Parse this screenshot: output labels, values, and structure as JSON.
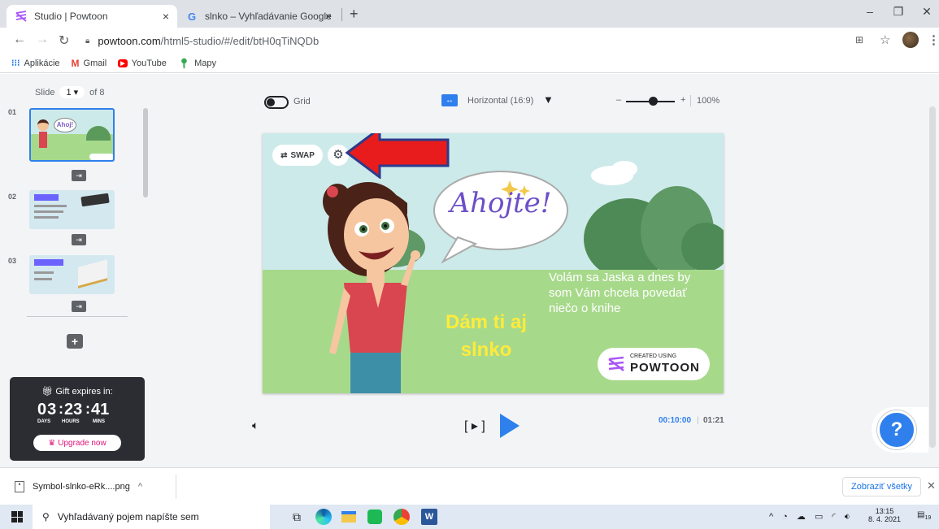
{
  "browser": {
    "tabs": [
      {
        "title": "Studio | Powtoon",
        "close": "×"
      },
      {
        "title": "slnko – Vyhľadávanie Google",
        "close": "×"
      }
    ],
    "new_tab": "+",
    "window_controls": {
      "minimize": "–",
      "restore": "❐",
      "close": "✕"
    },
    "url_domain": "powtoon.com",
    "url_path": "/html5-studio/#/edit/btH0qTiNQDb",
    "bookmarks": [
      "Aplikácie",
      "Gmail",
      "YouTube",
      "Mapy"
    ]
  },
  "sidebar": {
    "slide_label": "Slide",
    "slide_current": "1",
    "slide_of": "of 8",
    "slides": [
      {
        "number": "01"
      },
      {
        "number": "02"
      },
      {
        "number": "03"
      }
    ],
    "add_button": "+",
    "collapse": "‹",
    "gift": {
      "title": "Gift expires in:",
      "days": "03",
      "hours": "23",
      "mins": "41",
      "days_label": "DAYS",
      "hours_label": "HOURS",
      "mins_label": "MINS",
      "upgrade": "Upgrade now"
    }
  },
  "canvas_toolbar": {
    "grid_label": "Grid",
    "orientation": "Horizontal (16:9)",
    "zoom_minus": "–",
    "zoom_plus": "+",
    "zoom_value": "100%",
    "zoom_level": 0.55
  },
  "slide": {
    "swap_label": "SWAP",
    "greeting": "Ahojte!",
    "body_text": "Volám sa Jaska a dnes by som Vám chcela povedať niečo o knihe",
    "yellow_text": "Dám ti aj slnko",
    "badge_created": "CREATED USING",
    "badge_brand": "POWTOON"
  },
  "player": {
    "time_current": "00:10:00",
    "time_separator": "|",
    "time_total": "01:21",
    "help": "?"
  },
  "download": {
    "filename": "Symbol-slnko-eRk....png",
    "show_all": "Zobraziť všetky",
    "close": "✕"
  },
  "taskbar": {
    "search_placeholder": "Vyhľadávaný pojem napíšte sem",
    "time": "13:15",
    "date": "8. 4. 2021",
    "notifications": "19"
  },
  "colors": {
    "accent_blue": "#2f80ed",
    "highlight_red": "#e81c1c",
    "text_yellow": "#ffeb3b",
    "upgrade_pink": "#e0157a"
  }
}
